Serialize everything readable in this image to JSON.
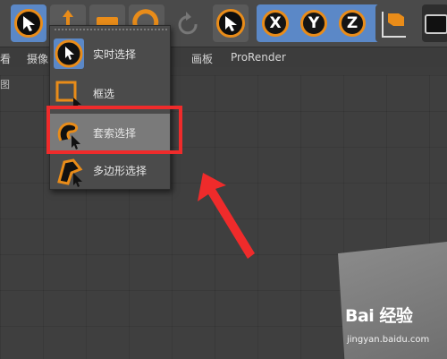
{
  "toolbar": {
    "axis_buttons": [
      {
        "label": "X"
      },
      {
        "label": "Y"
      },
      {
        "label": "Z"
      }
    ]
  },
  "menubar": {
    "items": [
      {
        "label": "看"
      },
      {
        "label": "摄像"
      },
      {
        "label": "画板"
      },
      {
        "label": "ProRender"
      }
    ]
  },
  "viewport": {
    "label": "图"
  },
  "selection_popup": {
    "items": [
      {
        "label": "实时选择",
        "icon": "live-selection-icon"
      },
      {
        "label": "框选",
        "icon": "rectangle-selection-icon"
      },
      {
        "label": "套索选择",
        "icon": "lasso-selection-icon",
        "highlighted": true
      },
      {
        "label": "多边形选择",
        "icon": "polygon-selection-icon"
      }
    ]
  },
  "watermark": {
    "logo": "Bai 经验",
    "url": "jingyan.baidu.com"
  },
  "colors": {
    "accent_orange": "#e98c19",
    "active_blue": "#5b88c7",
    "highlight_red": "#ef2b2b"
  }
}
